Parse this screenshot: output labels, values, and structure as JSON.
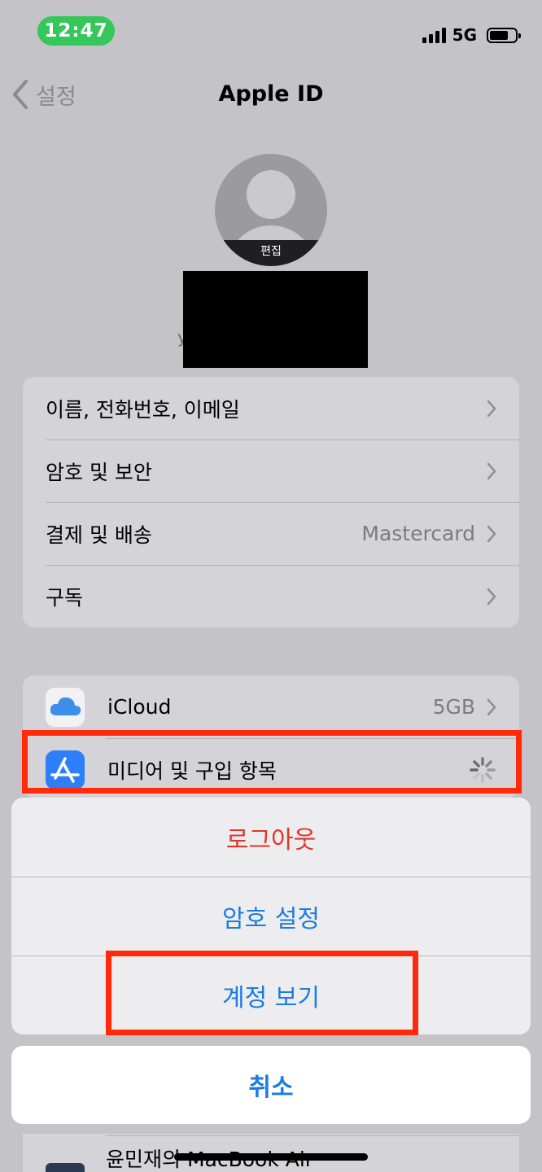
{
  "status_bar": {
    "time": "12:47",
    "network": "5G"
  },
  "nav": {
    "back_label": "설정",
    "title": "Apple ID"
  },
  "profile": {
    "edit_label": "편집",
    "email_fragment": "y"
  },
  "account_group": [
    {
      "label": "이름, 전화번호, 이메일",
      "value": ""
    },
    {
      "label": "암호 및 보안",
      "value": ""
    },
    {
      "label": "결제 및 배송",
      "value": "Mastercard"
    },
    {
      "label": "구독",
      "value": ""
    }
  ],
  "services_group": {
    "icloud": {
      "label": "iCloud",
      "value": "5GB",
      "icon": "cloud-icon"
    },
    "media": {
      "label": "미디어 및 구입 항목",
      "icon": "app-store-icon",
      "status": "loading-spinner"
    }
  },
  "action_sheet": {
    "items": [
      {
        "label": "로그아웃",
        "style": "destructive"
      },
      {
        "label": "암호 설정",
        "style": "default"
      },
      {
        "label": "계정 보기",
        "style": "default"
      }
    ],
    "cancel_label": "취소"
  },
  "device_row": {
    "label": "윤민재의 MacBook Air",
    "icon": "macbook-icon"
  },
  "colors": {
    "accent": "#1c7ce0",
    "destructive": "#e3342a",
    "highlight": "#ff2a0a",
    "status_pill": "#34c759"
  }
}
